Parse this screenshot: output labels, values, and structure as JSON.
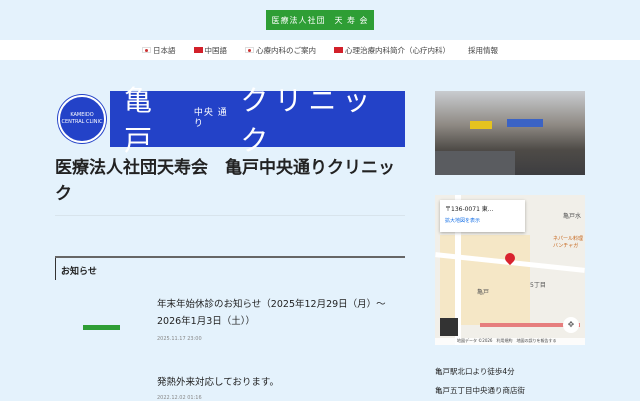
{
  "header": {
    "badge": "医療法人社団　天 寿 会"
  },
  "nav": [
    {
      "label": "日本語",
      "flag": "jp"
    },
    {
      "label": "中国語",
      "flag": "cn"
    },
    {
      "label": "心療内科のご案内",
      "flag": "jp"
    },
    {
      "label": "心理治療内科简介（心疗内科）",
      "flag": "cn"
    },
    {
      "label": "採用情報",
      "flag": ""
    }
  ],
  "logo": {
    "emblem": "KAMEIDO CENTRAL CLINIC",
    "main1": "亀戸",
    "small": "中央 通り",
    "main2": "クリニック"
  },
  "page_title": "医療法人社団天寿会　亀戸中央通りクリニック",
  "news": {
    "heading": "お知らせ",
    "items": [
      {
        "title": "年末年始休診のお知らせ（2025年12月29日（月）〜2026年1月3日（土））",
        "date": "2025.11.17 23:00"
      },
      {
        "title": "発熱外来対応しております。",
        "date": "2022.12.02 01:16"
      }
    ]
  },
  "map": {
    "address": "〒136-0071 東...",
    "link": "拡大地図を表示",
    "labels": {
      "area": "亀戸",
      "block": "5丁目",
      "north": "亀戸水",
      "shop": "ネパール料理 バンチャガ"
    },
    "attribution": "地図データ ©2026　利用規約　地図の誤りを報告する"
  },
  "access": [
    "亀戸駅北口より徒歩4分",
    "亀戸五丁目中央通り商店街"
  ]
}
